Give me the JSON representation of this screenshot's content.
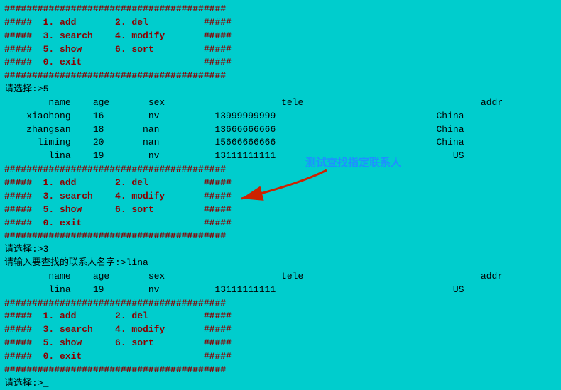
{
  "terminal": {
    "bg_color": "#00CDCD",
    "text_color": "#000000",
    "hash_color": "#8B0000",
    "annotation_color": "#1E90FF",
    "annotation_text": "测试查找指定联系人",
    "lines": [
      {
        "type": "hash",
        "text": "########################################"
      },
      {
        "type": "menu",
        "text": "#####  1. add       2. del          #####"
      },
      {
        "type": "menu",
        "text": "#####  3. search    4. modify       #####"
      },
      {
        "type": "menu",
        "text": "#####  5. show      6. sort         #####"
      },
      {
        "type": "menu",
        "text": "#####  0. exit                      #####"
      },
      {
        "type": "hash",
        "text": "########################################"
      },
      {
        "type": "prompt",
        "text": "请选择:>5"
      },
      {
        "type": "blank",
        "text": ""
      },
      {
        "type": "header",
        "text": "        name    age       sex                     tele                                addr"
      },
      {
        "type": "blank",
        "text": ""
      },
      {
        "type": "data",
        "text": "    xiaohong    16        nv          13999999999                             China"
      },
      {
        "type": "data",
        "text": "    zhangsan    18       nan          13666666666                             China"
      },
      {
        "type": "data",
        "text": "      liming    20       nan          15666666666                             China"
      },
      {
        "type": "data",
        "text": "        lina    19        nv          13111111111                                US"
      },
      {
        "type": "hash",
        "text": "########################################"
      },
      {
        "type": "menu",
        "text": "#####  1. add       2. del          #####"
      },
      {
        "type": "menu",
        "text": "#####  3. search    4. modify       #####"
      },
      {
        "type": "menu",
        "text": "#####  5. show      6. sort         #####"
      },
      {
        "type": "menu",
        "text": "#####  0. exit                      #####"
      },
      {
        "type": "hash",
        "text": "########################################"
      },
      {
        "type": "prompt",
        "text": "请选择:>3"
      },
      {
        "type": "prompt",
        "text": "请输入要查找的联系人名字:>lina"
      },
      {
        "type": "header",
        "text": "        name    age       sex                     tele                                addr"
      },
      {
        "type": "blank",
        "text": ""
      },
      {
        "type": "data",
        "text": "        lina    19        nv          13111111111                                US"
      },
      {
        "type": "blank",
        "text": ""
      },
      {
        "type": "hash",
        "text": "########################################"
      },
      {
        "type": "menu",
        "text": "#####  1. add       2. del          #####"
      },
      {
        "type": "menu",
        "text": "#####  3. search    4. modify       #####"
      },
      {
        "type": "menu",
        "text": "#####  5. show      6. sort         #####"
      },
      {
        "type": "menu",
        "text": "#####  0. exit                      #####"
      },
      {
        "type": "hash",
        "text": "########################################"
      },
      {
        "type": "prompt",
        "text": "请选择:>_"
      }
    ]
  }
}
